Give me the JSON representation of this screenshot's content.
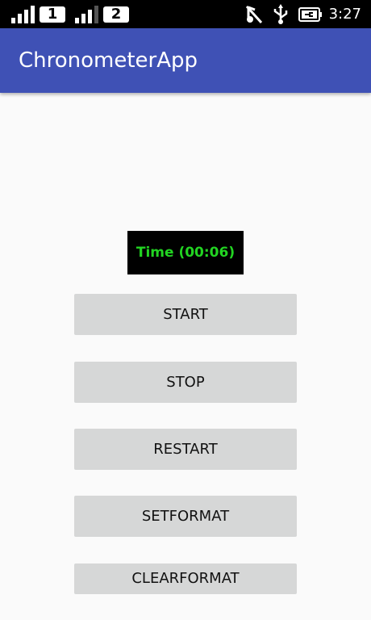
{
  "status_bar": {
    "sim1": "1",
    "sim2": "2",
    "time": "3:27",
    "icons": [
      "signal-icon",
      "signal-icon",
      "silent-icon",
      "usb-icon",
      "battery-charging-icon"
    ]
  },
  "app_bar": {
    "title": "ChronometerApp",
    "color": "#3f51b5"
  },
  "chronometer": {
    "text": "Time (00:06)",
    "text_color": "#22d422",
    "background": "#000000"
  },
  "buttons": {
    "start": "START",
    "stop": "STOP",
    "restart": "RESTART",
    "setformat": "SETFORMAT",
    "clearformat": "CLEARFORMAT"
  }
}
